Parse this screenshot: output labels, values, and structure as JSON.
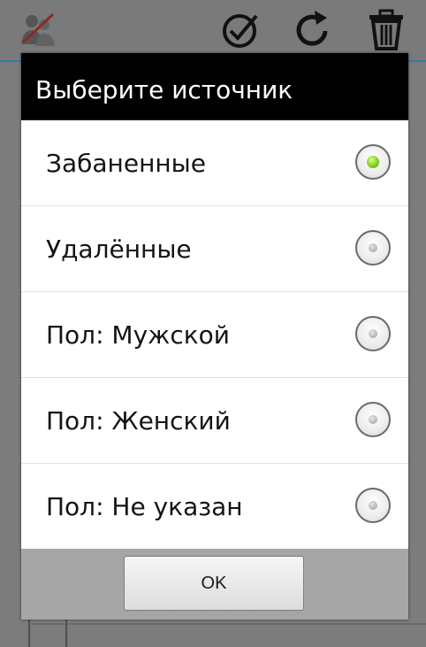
{
  "dialog": {
    "title": "Выберите источник",
    "options": [
      {
        "label": "Забаненные",
        "selected": true
      },
      {
        "label": "Удалённые",
        "selected": false
      },
      {
        "label": "Пол: Мужской",
        "selected": false
      },
      {
        "label": "Пол: Женский",
        "selected": false
      },
      {
        "label": "Пол: Не указан",
        "selected": false
      }
    ],
    "ok_label": "OK"
  },
  "actionbar": {
    "icons": [
      "user-blocked-icon",
      "checkmark-icon",
      "refresh-icon",
      "trash-icon"
    ]
  },
  "colors": {
    "accent": "#2f7f9e",
    "radio_selected": "#6cc20e",
    "title_bg": "#000000"
  }
}
